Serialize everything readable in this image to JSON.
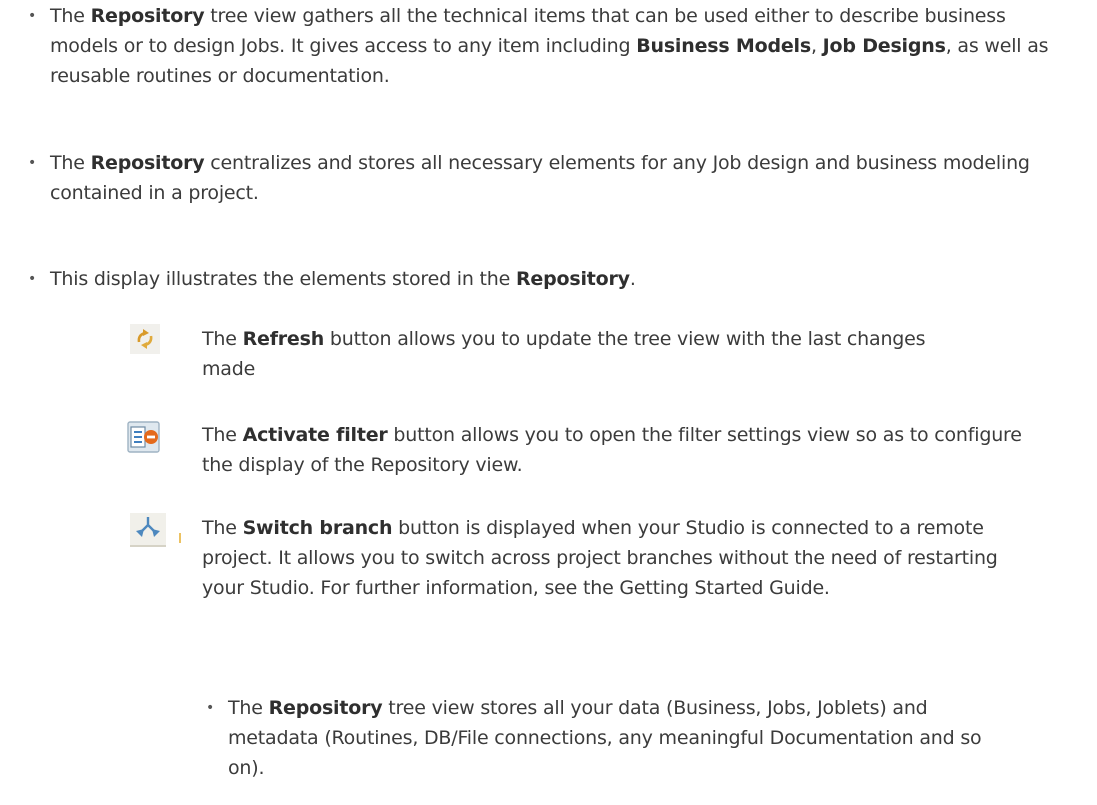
{
  "bullets": [
    {
      "before": "The ",
      "bold1": "Repository",
      "mid1": " tree view gathers all the technical items that can be used either to describe business models or to design Jobs. It gives access to any item including ",
      "bold2": "Business Models",
      "mid2": ", ",
      "bold3": "Job Designs",
      "after": ", as well as reusable routines or documentation."
    },
    {
      "before": "The ",
      "bold1": "Repository",
      "after": " centralizes and stores all necessary elements for any Job design and business modeling contained in a project."
    },
    {
      "before": "This display illustrates the elements stored in the ",
      "bold1": "Repository",
      "after": "."
    }
  ],
  "buttons": [
    {
      "icon": "refresh-icon",
      "before": "The ",
      "bold": "Refresh",
      "after": " button allows you to update the tree view with the last changes made"
    },
    {
      "icon": "activate-filter-icon",
      "before": "The ",
      "bold": "Activate filter",
      "after": " button allows you to open the filter settings view so as to configure the display of the Repository view."
    },
    {
      "icon": "switch-branch-icon",
      "before": "The ",
      "bold": "Switch branch",
      "after": " button is displayed when your Studio is connected to a remote project. It allows you to switch across project branches without the need of restarting your Studio. For further information, see the Getting Started Guide."
    }
  ],
  "sub_bullet": {
    "before": "The ",
    "bold": "Repository",
    "after": " tree view stores all your data (Business, Jobs, Joblets) and metadata (Routines, DB/File connections, any meaningful Documentation and so on)."
  },
  "bullet_glyph": "•"
}
